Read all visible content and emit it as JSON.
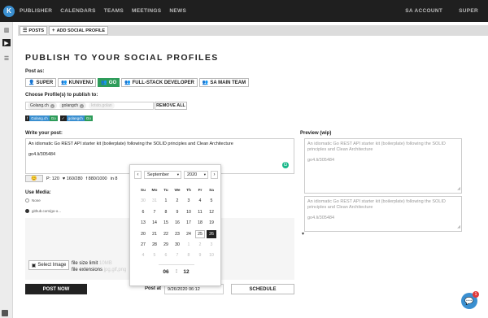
{
  "nav": {
    "logo": "K",
    "links": [
      "PUBLISHER",
      "CALENDARS",
      "TEAMS",
      "MEETINGS",
      "NEWS"
    ],
    "right": [
      "SA ACCOUNT",
      "SUPER"
    ]
  },
  "tabs": [
    {
      "icon": "list-icon",
      "glyph": "☰",
      "label": "POSTS"
    },
    {
      "icon": "plus-icon",
      "glyph": "+",
      "label": "ADD SOCIAL PROFILE"
    }
  ],
  "page": {
    "title": "PUBLISH TO YOUR SOCIAL PROFILES",
    "post_as_label": "Post as:",
    "accounts": [
      {
        "icon": "user-icon",
        "glyph": "👤",
        "label": "SUPER",
        "active": false
      },
      {
        "icon": "team-icon",
        "glyph": "👥",
        "label": "KUNVENU",
        "active": false
      },
      {
        "icon": "team-icon",
        "glyph": "👥",
        "label": "GO",
        "active": true
      },
      {
        "icon": "team-icon",
        "glyph": "👥",
        "label": "FULL-STACK DEVELOPER",
        "active": false
      },
      {
        "icon": "team-icon",
        "glyph": "👥",
        "label": "SA MAIN TEAM",
        "active": false
      }
    ],
    "choose_label": "Choose Profile(s) to publish to:",
    "profiles": [
      "Golang.ch",
      "golangch",
      "kristo.golan"
    ],
    "remove_all": "REMOVE ALL",
    "badges": [
      {
        "network": "f",
        "name": "Golang.ch",
        "team": "Go"
      },
      {
        "network": "✓",
        "name": "golangch",
        "team": "Go"
      }
    ]
  },
  "compose": {
    "label": "Write your post:",
    "text_line1": "An idiomatic Go REST API starter kit (boilerplate) following the SOLID principles and Clean Architecture",
    "text_line2": "go4.li/305484",
    "emoji": "😊",
    "counters": [
      {
        "icon": "pinterest-icon",
        "text": "P: 120"
      },
      {
        "icon": "twitter-icon",
        "text": "♥ 160/280"
      },
      {
        "icon": "facebook-icon",
        "text": "f 880/1000"
      },
      {
        "icon": "linkedin-icon",
        "text": "in 8"
      }
    ]
  },
  "media": {
    "label": "Use Media:",
    "none_label": "None",
    "url_label": "github.com/go-o...",
    "select_image": "Select Image",
    "size_label": "file size limit",
    "size_value": "10MB",
    "ext_label": "file extensions",
    "ext_value": "jpg,gif,png"
  },
  "actions": {
    "post_now": "POST NOW",
    "post_at_label": "Post at",
    "post_at_value": "9/26/2020 06:12",
    "schedule": "SCHEDULE"
  },
  "preview": {
    "label": "Preview (wip)",
    "boxes": [
      {
        "line1": "An idiomatic Go REST API starter kit (boilerplate) following the SOLID principles and Clean Architecture",
        "line2": "go4.li/305484"
      },
      {
        "line1": "An idiomatic Go REST API starter kit (boilerplate) following the SOLID principles and Clean Architecture",
        "line2": "go4.li/305484"
      }
    ]
  },
  "datepicker": {
    "month": "September",
    "year": "2020",
    "dow": [
      "Su",
      "Mo",
      "Tu",
      "We",
      "Th",
      "Fr",
      "Sa"
    ],
    "weeks": [
      [
        "30",
        "31",
        "1",
        "2",
        "3",
        "4",
        "5"
      ],
      [
        "6",
        "7",
        "8",
        "9",
        "10",
        "11",
        "12"
      ],
      [
        "13",
        "14",
        "15",
        "16",
        "17",
        "18",
        "19"
      ],
      [
        "20",
        "21",
        "22",
        "23",
        "24",
        "25",
        "26"
      ],
      [
        "27",
        "28",
        "29",
        "30",
        "1",
        "2",
        "3"
      ],
      [
        "4",
        "5",
        "6",
        "7",
        "8",
        "9",
        "10"
      ]
    ],
    "muted": [
      [
        0,
        0
      ],
      [
        0,
        1
      ],
      [
        4,
        4
      ],
      [
        4,
        5
      ],
      [
        4,
        6
      ],
      [
        5,
        0
      ],
      [
        5,
        1
      ],
      [
        5,
        2
      ],
      [
        5,
        3
      ],
      [
        5,
        4
      ],
      [
        5,
        5
      ],
      [
        5,
        6
      ]
    ],
    "today": [
      3,
      5
    ],
    "selected": [
      3,
      6
    ],
    "hour": "06",
    "minute": "12",
    "prev_glyph": "‹",
    "next_glyph": "›"
  },
  "chat": {
    "badge": "1",
    "glyph": "💬"
  }
}
